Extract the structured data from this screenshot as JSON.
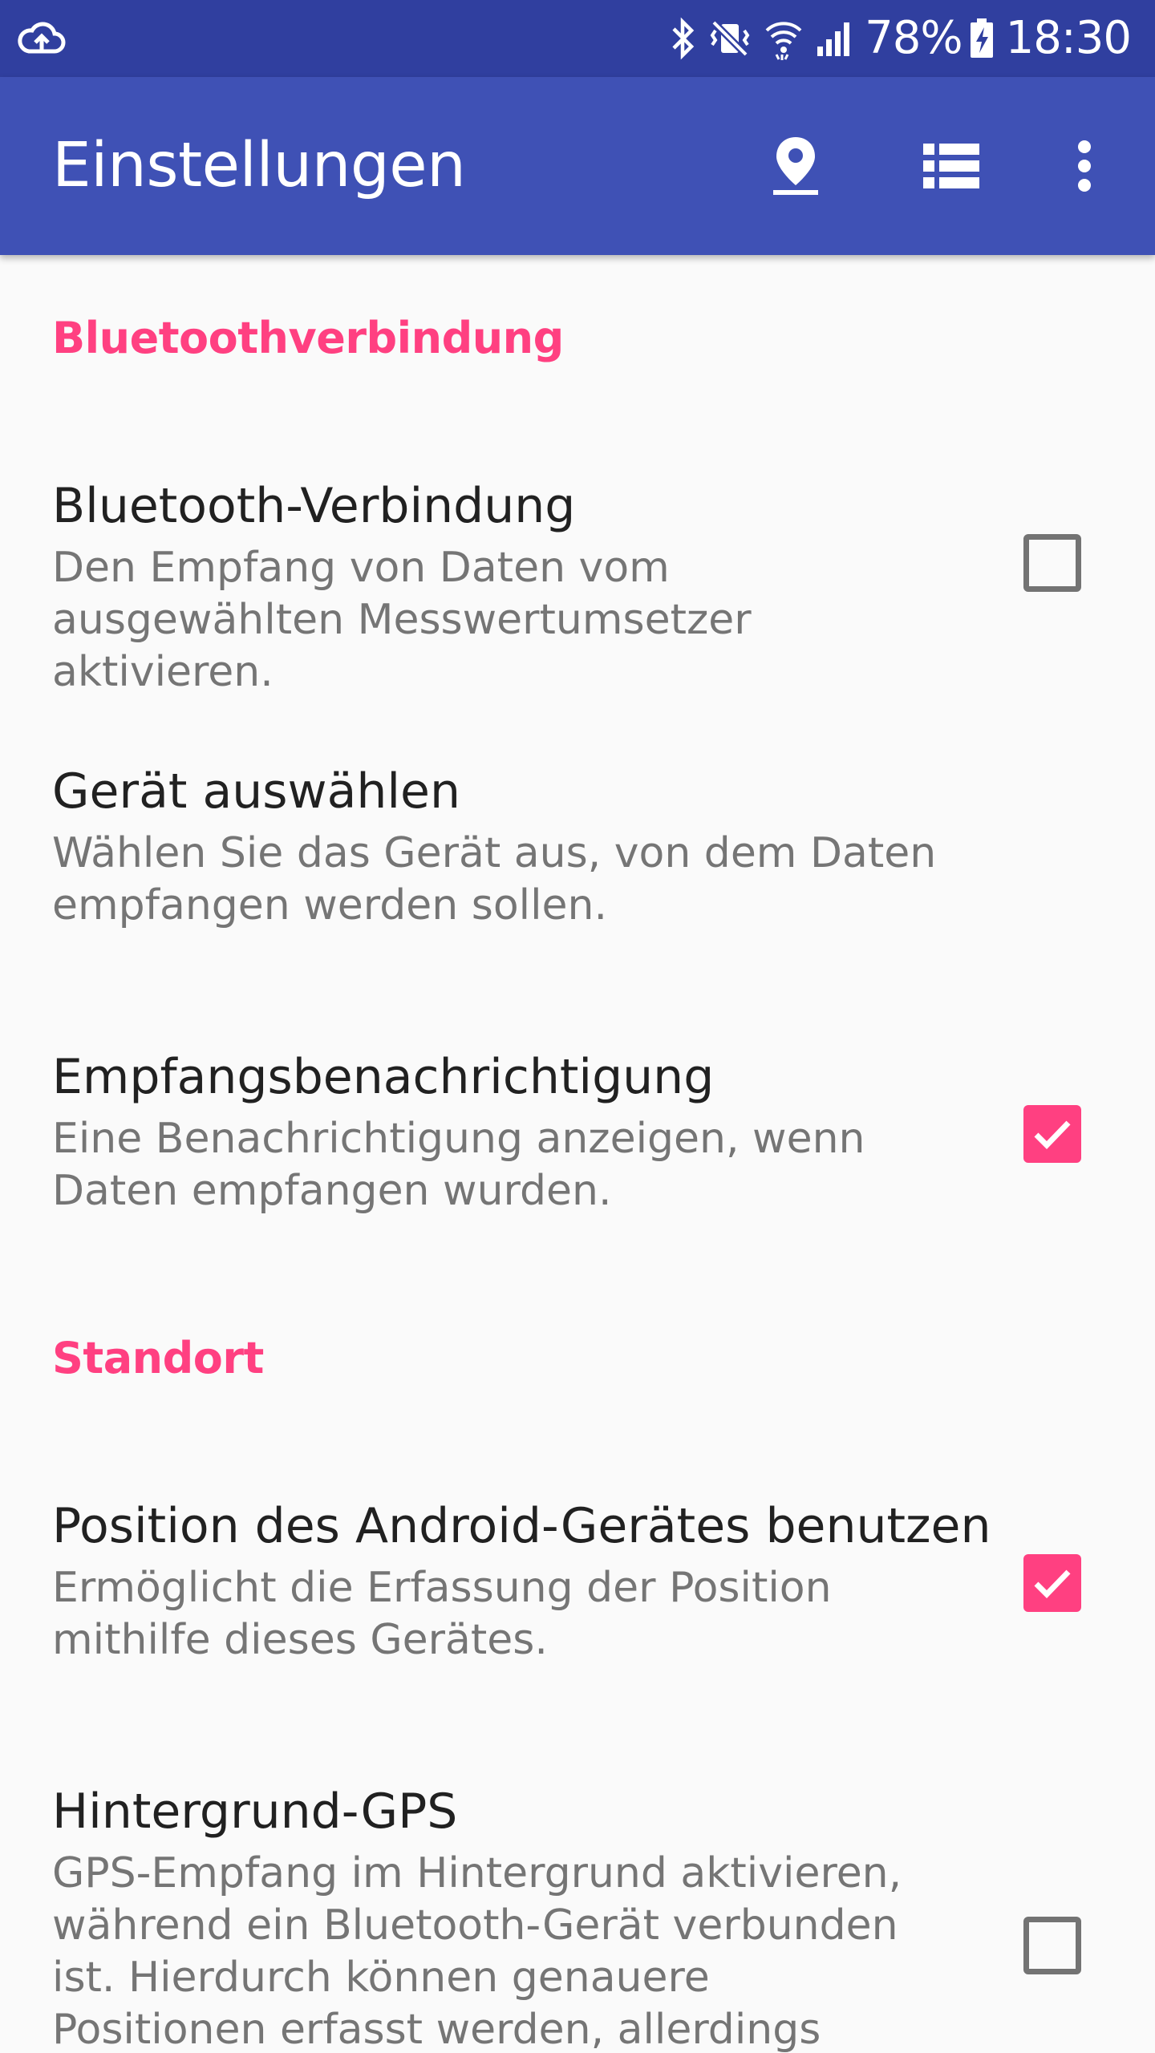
{
  "status_bar": {
    "battery": "78%",
    "time": "18:30",
    "icons": [
      "cloud-upload-icon",
      "bluetooth-icon",
      "vibrate-mute-icon",
      "wifi-icon",
      "cell-signal-icon",
      "battery-charging-icon"
    ]
  },
  "app_bar": {
    "title": "Einstellungen",
    "actions": [
      "location-pin-icon",
      "list-icon",
      "overflow-menu-icon"
    ]
  },
  "colors": {
    "status_bar": "#303f9f",
    "app_bar": "#3f51b5",
    "accent": "#ff4081",
    "background": "#fafafa"
  },
  "categories": {
    "bluetooth": "Bluetoothverbindung",
    "location": "Standort"
  },
  "prefs": {
    "bt_connection": {
      "title": "Bluetooth-Verbindung",
      "summary": "Den Empfang von Daten vom ausgewählten Messwertumsetzer aktivieren.",
      "checked": false
    },
    "select_device": {
      "title": "Gerät auswählen",
      "summary": "Wählen Sie das Gerät aus, von dem Daten empfangen werden sollen."
    },
    "receive_notification": {
      "title": "Empfangsbenachrichtigung",
      "summary": "Eine Benachrichtigung anzeigen, wenn Daten empfangen wurden.",
      "checked": true
    },
    "use_android_position": {
      "title": "Position des Android-Gerätes benutzen",
      "summary": "Ermöglicht die Erfassung der Position mithilfe dieses Gerätes.",
      "checked": true
    },
    "background_gps": {
      "title": "Hintergrund-GPS",
      "summary": "GPS-Empfang im Hintergrund aktivieren, während ein Bluetooth-Gerät verbunden ist. Hierdurch können genauere Positionen erfasst werden, allerdings steigt der",
      "checked": false
    }
  }
}
